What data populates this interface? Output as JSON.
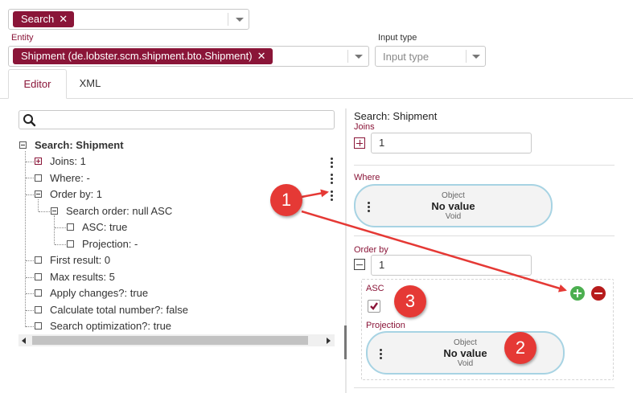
{
  "top_selector": {
    "chip_label": "Search",
    "remove_symbol": "✕"
  },
  "entity": {
    "label": "Entity",
    "chip_label": "Shipment (de.lobster.scm.shipment.bto.Shipment)",
    "remove_symbol": "✕"
  },
  "input_type": {
    "label": "Input type",
    "placeholder": "Input type"
  },
  "tabs": [
    {
      "label": "Editor",
      "active": true
    },
    {
      "label": "XML",
      "active": false
    }
  ],
  "tree": {
    "search_placeholder": "",
    "root": "Search: Shipment",
    "items": [
      {
        "label": "Joins: 1"
      },
      {
        "label": "Where: -"
      },
      {
        "label": "Order by: 1"
      },
      {
        "label": "Search order: null ASC"
      },
      {
        "label": "ASC: true"
      },
      {
        "label": "Projection: -"
      },
      {
        "label": "First result: 0"
      },
      {
        "label": "Max results: 5"
      },
      {
        "label": "Apply changes?: true"
      },
      {
        "label": "Calculate total number?: false"
      },
      {
        "label": "Search optimization?: true"
      }
    ]
  },
  "editor": {
    "title": "Search: Shipment",
    "joins_label": "Joins",
    "joins_value": "1",
    "where_label": "Where",
    "where_object": {
      "type": "Object",
      "value": "No value",
      "subtype": "Void"
    },
    "order_by_label": "Order by",
    "order_by_value": "1",
    "asc_label": "ASC",
    "asc_checked": true,
    "projection_label": "Projection",
    "projection_object": {
      "type": "Object",
      "value": "No value",
      "subtype": "Void"
    }
  },
  "annotations": [
    {
      "number": "1"
    },
    {
      "number": "2"
    },
    {
      "number": "3"
    }
  ],
  "colors": {
    "accent": "#8a1538",
    "annotation": "#e53935",
    "pill_border": "#a7d3e3",
    "add": "#4caf50",
    "remove": "#b71c1c"
  }
}
